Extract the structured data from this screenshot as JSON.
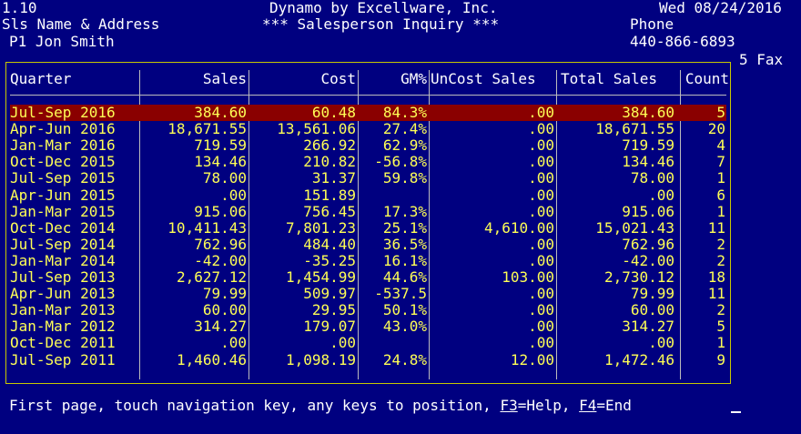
{
  "header": {
    "version": "1.10",
    "company": "Dynamo by Excellware, Inc.",
    "date": "Wed 08/24/2016",
    "address_label": "Sls Name & Address",
    "screen_title": "*** Salesperson Inquiry ***",
    "phone_label": "Phone",
    "salesperson": "P1 Jon Smith",
    "phone": "440-866-6893",
    "fax_label": "5 Fax"
  },
  "table": {
    "columns": [
      "Quarter",
      "Sales",
      "Cost",
      "GM%",
      "UnCost Sales",
      "Total Sales",
      "Count"
    ],
    "selected_index": 0,
    "rows": [
      {
        "quarter": "Jul-Sep 2016",
        "sales": "384.60",
        "cost": "60.48",
        "gm": "84.3%",
        "uncost": ".00",
        "total": "384.60",
        "count": "5"
      },
      {
        "quarter": "Apr-Jun 2016",
        "sales": "18,671.55",
        "cost": "13,561.06",
        "gm": "27.4%",
        "uncost": ".00",
        "total": "18,671.55",
        "count": "20"
      },
      {
        "quarter": "Jan-Mar 2016",
        "sales": "719.59",
        "cost": "266.92",
        "gm": "62.9%",
        "uncost": ".00",
        "total": "719.59",
        "count": "4"
      },
      {
        "quarter": "Oct-Dec 2015",
        "sales": "134.46",
        "cost": "210.82",
        "gm": "-56.8%",
        "uncost": ".00",
        "total": "134.46",
        "count": "7"
      },
      {
        "quarter": "Jul-Sep 2015",
        "sales": "78.00",
        "cost": "31.37",
        "gm": "59.8%",
        "uncost": ".00",
        "total": "78.00",
        "count": "1"
      },
      {
        "quarter": "Apr-Jun 2015",
        "sales": ".00",
        "cost": "151.89",
        "gm": "",
        "uncost": ".00",
        "total": ".00",
        "count": "6"
      },
      {
        "quarter": "Jan-Mar 2015",
        "sales": "915.06",
        "cost": "756.45",
        "gm": "17.3%",
        "uncost": ".00",
        "total": "915.06",
        "count": "1"
      },
      {
        "quarter": "Oct-Dec 2014",
        "sales": "10,411.43",
        "cost": "7,801.23",
        "gm": "25.1%",
        "uncost": "4,610.00",
        "total": "15,021.43",
        "count": "11"
      },
      {
        "quarter": "Jul-Sep 2014",
        "sales": "762.96",
        "cost": "484.40",
        "gm": "36.5%",
        "uncost": ".00",
        "total": "762.96",
        "count": "2"
      },
      {
        "quarter": "Jan-Mar 2014",
        "sales": "-42.00",
        "cost": "-35.25",
        "gm": "16.1%",
        "uncost": ".00",
        "total": "-42.00",
        "count": "2"
      },
      {
        "quarter": "Jul-Sep 2013",
        "sales": "2,627.12",
        "cost": "1,454.99",
        "gm": "44.6%",
        "uncost": "103.00",
        "total": "2,730.12",
        "count": "18"
      },
      {
        "quarter": "Apr-Jun 2013",
        "sales": "79.99",
        "cost": "509.97",
        "gm": "-537.5",
        "uncost": ".00",
        "total": "79.99",
        "count": "11"
      },
      {
        "quarter": "Jan-Mar 2013",
        "sales": "60.00",
        "cost": "29.95",
        "gm": "50.1%",
        "uncost": ".00",
        "total": "60.00",
        "count": "2"
      },
      {
        "quarter": "Jan-Mar 2012",
        "sales": "314.27",
        "cost": "179.07",
        "gm": "43.0%",
        "uncost": ".00",
        "total": "314.27",
        "count": "5"
      },
      {
        "quarter": "Oct-Dec 2011",
        "sales": ".00",
        "cost": ".00",
        "gm": "",
        "uncost": ".00",
        "total": ".00",
        "count": "1"
      },
      {
        "quarter": "Jul-Sep 2011",
        "sales": "1,460.46",
        "cost": "1,098.19",
        "gm": "24.8%",
        "uncost": "12.00",
        "total": "1,472.46",
        "count": "9"
      }
    ]
  },
  "footer": {
    "prefix": "First page, touch navigation key, any keys to position, ",
    "help_key": "F3",
    "help_text": "=Help, ",
    "end_key": "F4",
    "end_text": "=End"
  },
  "colors": {
    "background": "#000080",
    "text": "#ffffff",
    "data": "#ffff55",
    "selected_row": "#8a0000",
    "frame": "#c8c800"
  }
}
